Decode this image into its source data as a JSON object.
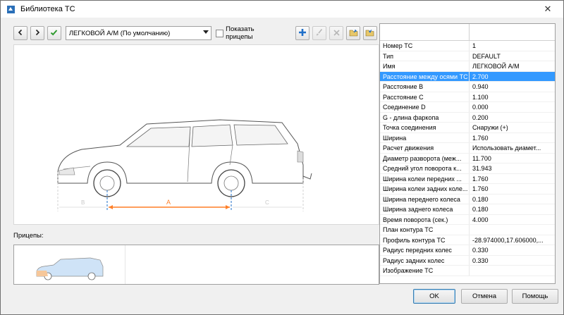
{
  "window": {
    "title": "Библиотека ТС"
  },
  "icons": {
    "app": "truck-app-icon",
    "back": "chevron-left-icon",
    "forward": "chevron-right-icon",
    "apply": "checkmark-icon",
    "add": "plus-icon",
    "edit": "paint-brush-icon",
    "delete": "x-delete-icon",
    "import": "folder-open-icon",
    "export": "folder-export-icon",
    "close": "close-icon"
  },
  "colors": {
    "selection": "#3399ff",
    "dimension_accent": "#ff7f27",
    "apply_green": "#2e9a2e",
    "add_blue": "#1f6fc8"
  },
  "toolbar": {
    "vehicle_select": "ЛЕГКОВОЙ А/М (По умолчанию)",
    "show_trailers_label": "Показать прицепы",
    "show_trailers_checked": false
  },
  "preview": {
    "dim_a": "A",
    "dim_b": "B",
    "dim_c": "C"
  },
  "trailers": {
    "label": "Прицепы:"
  },
  "properties": [
    {
      "key": "Номер ТС",
      "value": "1"
    },
    {
      "key": "Тип",
      "value": "DEFAULT"
    },
    {
      "key": "Имя",
      "value": "ЛЕГКОВОЙ А/М"
    },
    {
      "key": "Расстояние между осями ТС",
      "value": "2.700",
      "selected": true
    },
    {
      "key": "Расстояние B",
      "value": "0.940"
    },
    {
      "key": "Расстояние C",
      "value": "1.100"
    },
    {
      "key": "Соединение D",
      "value": "0.000"
    },
    {
      "key": "G - длина фаркопа",
      "value": "0.200"
    },
    {
      "key": "Точка соединения",
      "value": "Снаружи (+)"
    },
    {
      "key": "Ширина",
      "value": "1.760"
    },
    {
      "key": "Расчет движения",
      "value": "Использовать диамет..."
    },
    {
      "key": "Диаметр разворота (меж...",
      "value": "11.700"
    },
    {
      "key": "Средний угол поворота к...",
      "value": "31.943"
    },
    {
      "key": "Ширина колеи передних ...",
      "value": "1.760"
    },
    {
      "key": "Ширина колеи задних коле...",
      "value": "1.760"
    },
    {
      "key": "Ширина переднего колеса",
      "value": "0.180"
    },
    {
      "key": "Ширина заднего колеса",
      "value": "0.180"
    },
    {
      "key": "Время поворота (сек.)",
      "value": "4.000"
    },
    {
      "key": "План контура ТС",
      "value": ""
    },
    {
      "key": "Профиль контура ТС",
      "value": "-28.974000,17.606000,..."
    },
    {
      "key": "Радиус передних колес",
      "value": "0.330"
    },
    {
      "key": "Радиус задних колес",
      "value": "0.330"
    },
    {
      "key": "Изображение ТС",
      "value": ""
    }
  ],
  "buttons": {
    "ok": "OK",
    "cancel": "Отмена",
    "help": "Помощь"
  }
}
